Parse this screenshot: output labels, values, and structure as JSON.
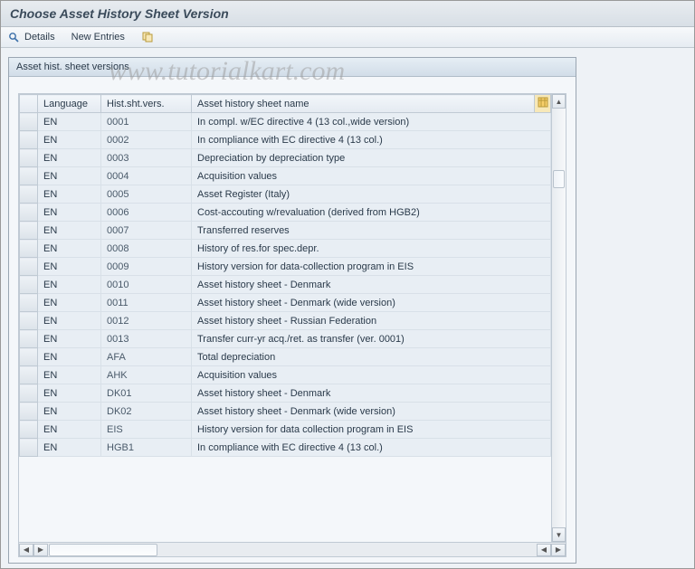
{
  "title": "Choose Asset History Sheet Version",
  "toolbar": {
    "details_label": "Details",
    "new_entries_label": "New Entries"
  },
  "panel": {
    "title": "Asset hist. sheet versions"
  },
  "columns": {
    "language": "Language",
    "version": "Hist.sht.vers.",
    "name": "Asset history sheet name"
  },
  "rows": [
    {
      "lang": "EN",
      "ver": "0001",
      "name": "In compl. w/EC directive 4 (13 col.,wide version)"
    },
    {
      "lang": "EN",
      "ver": "0002",
      "name": "In compliance with EC directive 4 (13 col.)"
    },
    {
      "lang": "EN",
      "ver": "0003",
      "name": "Depreciation by depreciation type"
    },
    {
      "lang": "EN",
      "ver": "0004",
      "name": "Acquisition values"
    },
    {
      "lang": "EN",
      "ver": "0005",
      "name": "Asset Register (Italy)"
    },
    {
      "lang": "EN",
      "ver": "0006",
      "name": "Cost-accouting w/revaluation (derived from HGB2)"
    },
    {
      "lang": "EN",
      "ver": "0007",
      "name": "Transferred reserves"
    },
    {
      "lang": "EN",
      "ver": "0008",
      "name": "History of res.for spec.depr."
    },
    {
      "lang": "EN",
      "ver": "0009",
      "name": "History version for data-collection program in EIS"
    },
    {
      "lang": "EN",
      "ver": "0010",
      "name": "Asset history sheet - Denmark"
    },
    {
      "lang": "EN",
      "ver": "0011",
      "name": "Asset history sheet - Denmark (wide version)"
    },
    {
      "lang": "EN",
      "ver": "0012",
      "name": "Asset history sheet - Russian Federation"
    },
    {
      "lang": "EN",
      "ver": "0013",
      "name": "Transfer curr-yr acq./ret. as transfer (ver. 0001)"
    },
    {
      "lang": "EN",
      "ver": "AFA",
      "name": "Total depreciation"
    },
    {
      "lang": "EN",
      "ver": "AHK",
      "name": "Acquisition values"
    },
    {
      "lang": "EN",
      "ver": "DK01",
      "name": "Asset history sheet - Denmark"
    },
    {
      "lang": "EN",
      "ver": "DK02",
      "name": "Asset history sheet - Denmark (wide version)"
    },
    {
      "lang": "EN",
      "ver": "EIS",
      "name": "History version for data collection program in EIS"
    },
    {
      "lang": "EN",
      "ver": "HGB1",
      "name": "In compliance with EC directive 4 (13 col.)"
    }
  ],
  "watermark": "www.tutorialkart.com"
}
